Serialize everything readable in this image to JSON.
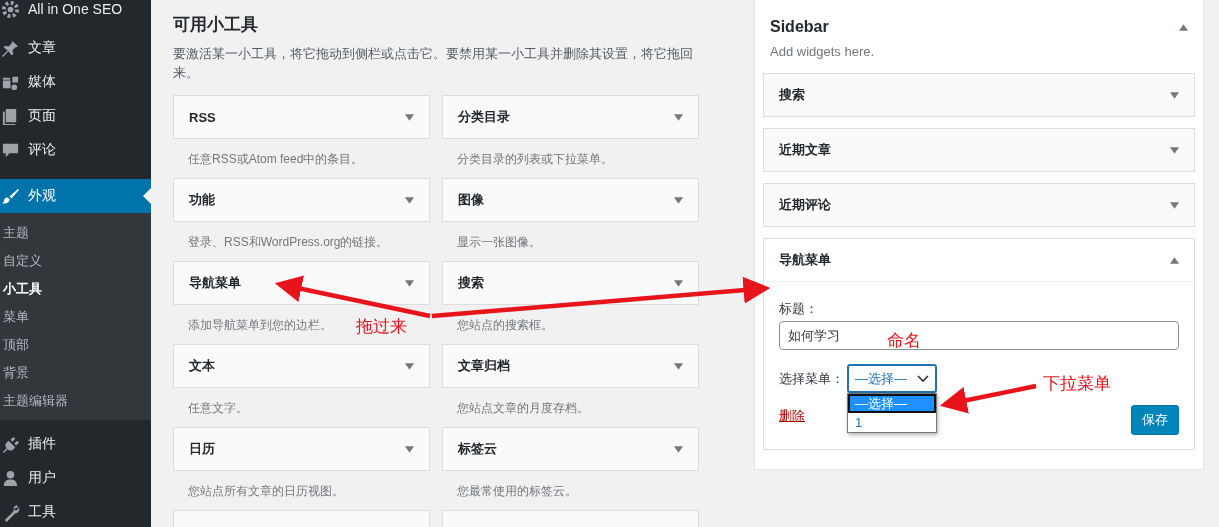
{
  "admin_menu": {
    "items": [
      {
        "label": "All in One SEO",
        "selected": false
      },
      {
        "label": "文章",
        "selected": false
      },
      {
        "label": "媒体",
        "selected": false
      },
      {
        "label": "页面",
        "selected": false
      },
      {
        "label": "评论",
        "selected": false
      },
      {
        "label": "外观",
        "selected": true,
        "children": [
          {
            "label": "主题",
            "selected": false
          },
          {
            "label": "自定义",
            "selected": false
          },
          {
            "label": "小工具",
            "selected": true
          },
          {
            "label": "菜单",
            "selected": false
          },
          {
            "label": "顶部",
            "selected": false
          },
          {
            "label": "背景",
            "selected": false
          },
          {
            "label": "主题编辑器",
            "selected": false
          }
        ]
      },
      {
        "label": "插件",
        "selected": false
      },
      {
        "label": "用户",
        "selected": false
      },
      {
        "label": "工具",
        "selected": false
      }
    ]
  },
  "available_widgets": {
    "title": "可用小工具",
    "description": "要激活某一小工具，将它拖动到侧栏或点击它。要禁用某一小工具并删除其设置，将它拖回来。",
    "widgets": [
      {
        "title": "RSS",
        "description": "任意RSS或Atom feed中的条目。"
      },
      {
        "title": "分类目录",
        "description": "分类目录的列表或下拉菜单。"
      },
      {
        "title": "功能",
        "description": "登录、RSS和WordPress.org的链接。"
      },
      {
        "title": "图像",
        "description": "显示一张图像。"
      },
      {
        "title": "导航菜单",
        "description": "添加导航菜单到您的边栏。"
      },
      {
        "title": "搜索",
        "description": "您站点的搜索框。"
      },
      {
        "title": "文本",
        "description": "任意文字。"
      },
      {
        "title": "文章归档",
        "description": "您站点文章的月度存档。"
      },
      {
        "title": "日历",
        "description": "您站点所有文章的日历视图。"
      },
      {
        "title": "标签云",
        "description": "您最常使用的标签云。"
      }
    ]
  },
  "sidebar_area": {
    "title": "Sidebar",
    "description": "Add widgets here.",
    "expanded": true,
    "widgets": [
      {
        "title": "搜索",
        "expanded": false
      },
      {
        "title": "近期文章",
        "expanded": false
      },
      {
        "title": "近期评论",
        "expanded": false
      },
      {
        "title": "导航菜单",
        "expanded": true
      }
    ],
    "form": {
      "title_label": "标题：",
      "title_value": "如何学习",
      "menu_label": "选择菜单：",
      "menu_value": "—选择—",
      "menu_options": [
        {
          "label": "—选择—",
          "selected": true
        },
        {
          "label": "1",
          "selected": false
        }
      ],
      "delete_link": "删除",
      "save_button": "保存"
    }
  },
  "annotations": [
    {
      "text": "拖过来"
    },
    {
      "text": "命名"
    },
    {
      "text": "下拉菜单"
    }
  ]
}
